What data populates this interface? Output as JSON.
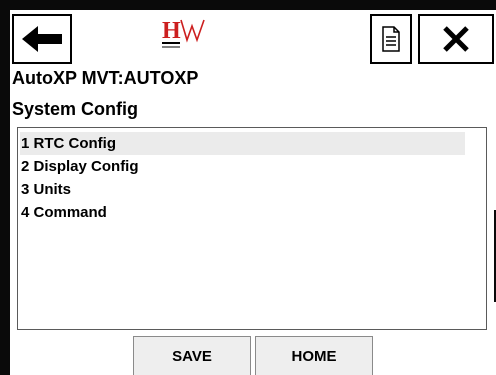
{
  "header": {
    "back_icon": "arrow-left-icon",
    "logo_icon": "hw-logo-icon",
    "doc_icon": "document-icon",
    "close_icon": "close-icon"
  },
  "device": {
    "title": "AutoXP MVT:AUTOXP"
  },
  "page": {
    "title": "System Config"
  },
  "menu": {
    "items": [
      {
        "label": "1 RTC Config",
        "selected": true
      },
      {
        "label": "2 Display Config",
        "selected": false
      },
      {
        "label": "3 Units",
        "selected": false
      },
      {
        "label": "4 Command",
        "selected": false
      }
    ]
  },
  "actions": {
    "save_label": "SAVE",
    "home_label": "HOME"
  },
  "colors": {
    "frame": "#0a0a0a",
    "logo_red": "#cc1f1f",
    "selected_row": "#ebebeb",
    "button_bg": "#eeeeee"
  }
}
